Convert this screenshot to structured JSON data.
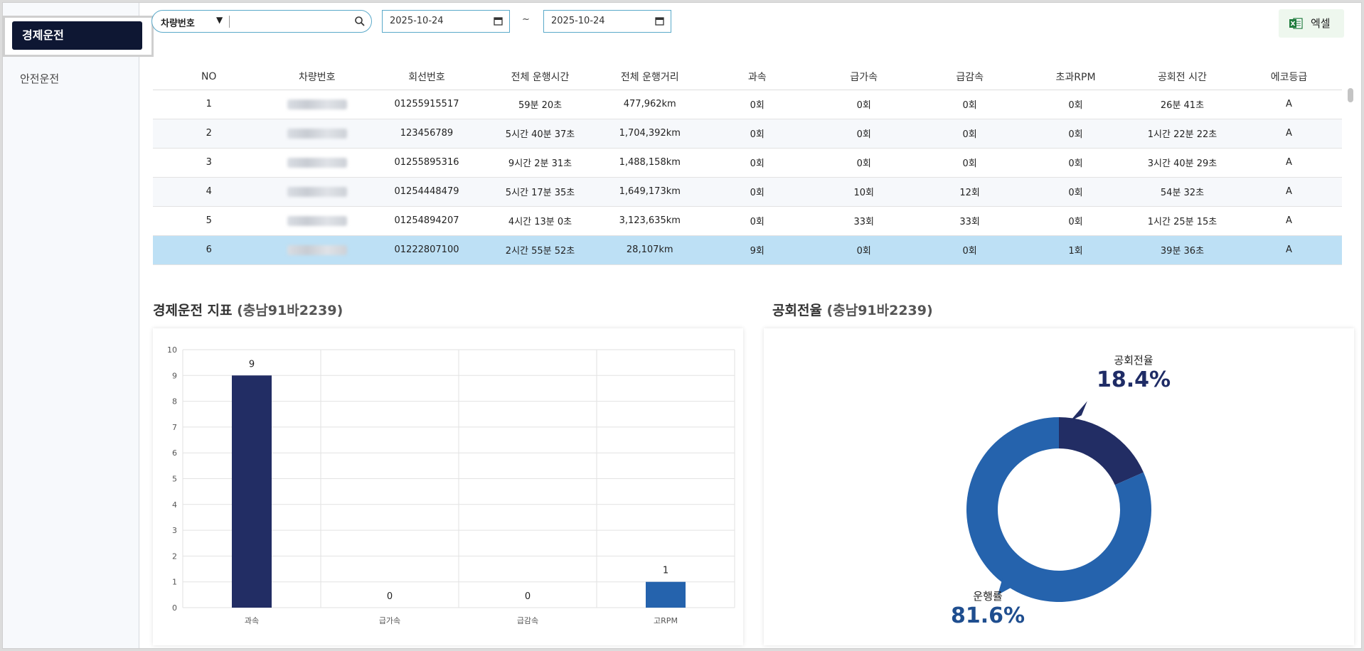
{
  "sidebar": {
    "items": [
      {
        "label": "경제운전",
        "active": true
      },
      {
        "label": "안전운전",
        "active": false
      }
    ]
  },
  "toolbar": {
    "search_select": "차량번호",
    "search_value": "",
    "date_from": "2025-10-24",
    "date_sep": "~",
    "date_to": "2025-10-24",
    "excel_label": "엑셀"
  },
  "table": {
    "headers": [
      "NO",
      "차량번호",
      "회선번호",
      "전체 운행시간",
      "전체 운행거리",
      "과속",
      "급가속",
      "급감속",
      "초과RPM",
      "공회전 시간",
      "에코등급"
    ],
    "rows": [
      [
        "1",
        "",
        "01255915517",
        "59분 20초",
        "477,962km",
        "0회",
        "0회",
        "0회",
        "0회",
        "26분 41초",
        "A"
      ],
      [
        "2",
        "",
        "123456789",
        "5시간 40분 37초",
        "1,704,392km",
        "0회",
        "0회",
        "0회",
        "0회",
        "1시간 22분 22초",
        "A"
      ],
      [
        "3",
        "",
        "01255895316",
        "9시간 2분 31초",
        "1,488,158km",
        "0회",
        "0회",
        "0회",
        "0회",
        "3시간 40분 29초",
        "A"
      ],
      [
        "4",
        "",
        "01254448479",
        "5시간 17분 35초",
        "1,649,173km",
        "0회",
        "10회",
        "12회",
        "0회",
        "54분 32초",
        "A"
      ],
      [
        "5",
        "",
        "01254894207",
        "4시간 13분 0초",
        "3,123,635km",
        "0회",
        "33회",
        "33회",
        "0회",
        "1시간 25분 15초",
        "A"
      ],
      [
        "6",
        "",
        "01222807100",
        "2시간 55분 52초",
        "28,107km",
        "9회",
        "0회",
        "0회",
        "1회",
        "39분 36초",
        "A"
      ]
    ],
    "selected_row": 6
  },
  "left_section": {
    "title": "경제운전 지표",
    "subtitle": "(충남91바2239)"
  },
  "right_section": {
    "title": "공회전율",
    "subtitle": "(충남91바2239)"
  },
  "chart_data": [
    {
      "type": "bar",
      "categories": [
        "과속",
        "급가속",
        "급감속",
        "고RPM"
      ],
      "values": [
        9,
        0,
        0,
        1
      ],
      "ylim": [
        0,
        10
      ],
      "yticks": [
        "0",
        "1",
        "2",
        "3",
        "4",
        "5",
        "6",
        "7",
        "8",
        "9",
        "10"
      ],
      "colors": [
        "#222d64",
        "#222d64",
        "#222d64",
        "#2563ad"
      ],
      "grid": true
    },
    {
      "type": "pie",
      "labels": [
        "공회전율",
        "운행률"
      ],
      "values": [
        18.4,
        81.6
      ],
      "value_labels": [
        "18.4%",
        "81.6%"
      ],
      "colors": [
        "#222d64",
        "#2563ad"
      ]
    }
  ]
}
